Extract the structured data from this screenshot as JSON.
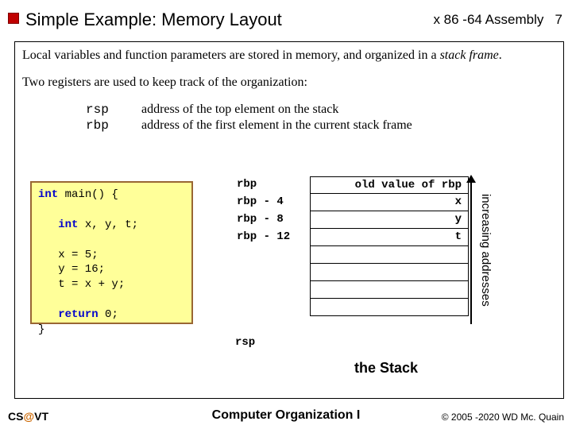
{
  "header": {
    "title": "Simple Example:  Memory Layout",
    "topic": "x 86 -64 Assembly",
    "page": "7"
  },
  "body": {
    "p1a": "Local variables and function parameters are stored in memory, and organized in a ",
    "p1b": "stack frame",
    "p1c": ".",
    "p2": "Two registers are used to keep track of the organization:",
    "regs": [
      {
        "name": "rsp",
        "desc": "address of the top element on the stack"
      },
      {
        "name": "rbp",
        "desc": "address of the first element in the current stack frame"
      }
    ]
  },
  "code": {
    "l0a": "int",
    "l0b": " main() {",
    "l1a": "int",
    "l1b": " x, y, t;",
    "l2": "   x = 5;",
    "l3": "   y = 16;",
    "l4": "   t = x + y;",
    "l5a": "return",
    "l5b": " 0;",
    "l6": "}"
  },
  "stack": {
    "rows": [
      {
        "label": "rbp",
        "value": "old value of rbp"
      },
      {
        "label": "rbp - 4",
        "value": "x"
      },
      {
        "label": "rbp - 8",
        "value": "y"
      },
      {
        "label": "rbp - 12",
        "value": "t"
      },
      {
        "label": "",
        "value": ""
      },
      {
        "label": "",
        "value": ""
      },
      {
        "label": "",
        "value": ""
      },
      {
        "label": "",
        "value": ""
      }
    ],
    "rsp": "rsp",
    "arrow": "increasing addresses",
    "caption": "the Stack"
  },
  "footer": {
    "left_a": "CS",
    "left_at": "@",
    "left_b": "VT",
    "center": "Computer Organization I",
    "right": "© 2005 -2020 WD Mc. Quain"
  }
}
